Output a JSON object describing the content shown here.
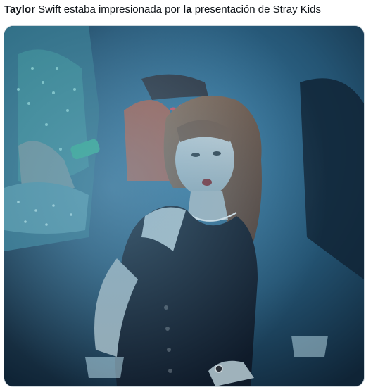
{
  "post": {
    "caption_parts": [
      {
        "text": "Taylor",
        "bold": true
      },
      {
        "text": " Swift estaba impresionada por ",
        "bold": false
      },
      {
        "text": "la",
        "bold": true
      },
      {
        "text": " presentación de Stray Kids",
        "bold": false
      }
    ]
  },
  "media": {
    "kind": "photo",
    "dominant_tint": "#2a5f86",
    "accent_colors": [
      "#c75a3a",
      "#2fa58a",
      "#0b1622"
    ]
  }
}
